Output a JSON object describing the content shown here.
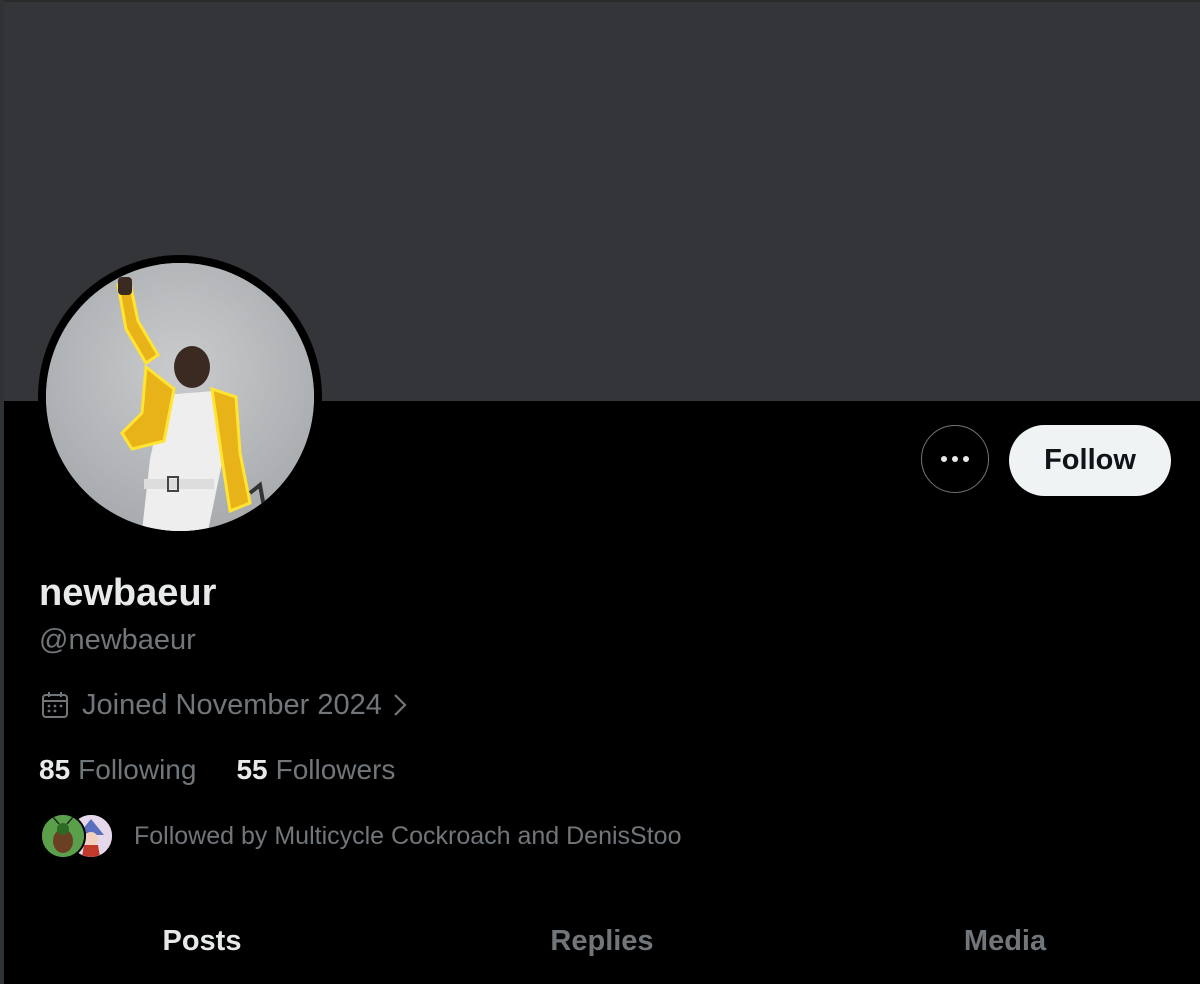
{
  "profile": {
    "display_name": "newbaeur",
    "handle": "@newbaeur",
    "joined": "Joined November 2024"
  },
  "actions": {
    "more_label": "···",
    "follow_label": "Follow"
  },
  "stats": {
    "following_count": "85",
    "following_label": "Following",
    "followers_count": "55",
    "followers_label": "Followers"
  },
  "followed_by": {
    "text": "Followed by Multicycle Cockroach and DenisStoo"
  },
  "tabs": [
    {
      "label": "Posts",
      "active": true
    },
    {
      "label": "Replies",
      "active": false
    },
    {
      "label": "Media",
      "active": false
    }
  ],
  "colors": {
    "background": "#000000",
    "banner": "#333539",
    "primary_text": "#e7e9ea",
    "secondary_text": "#71767b",
    "follow_button_bg": "#eff3f4",
    "avatar_glow": "#ffe433",
    "jacket": "#e8b318"
  }
}
